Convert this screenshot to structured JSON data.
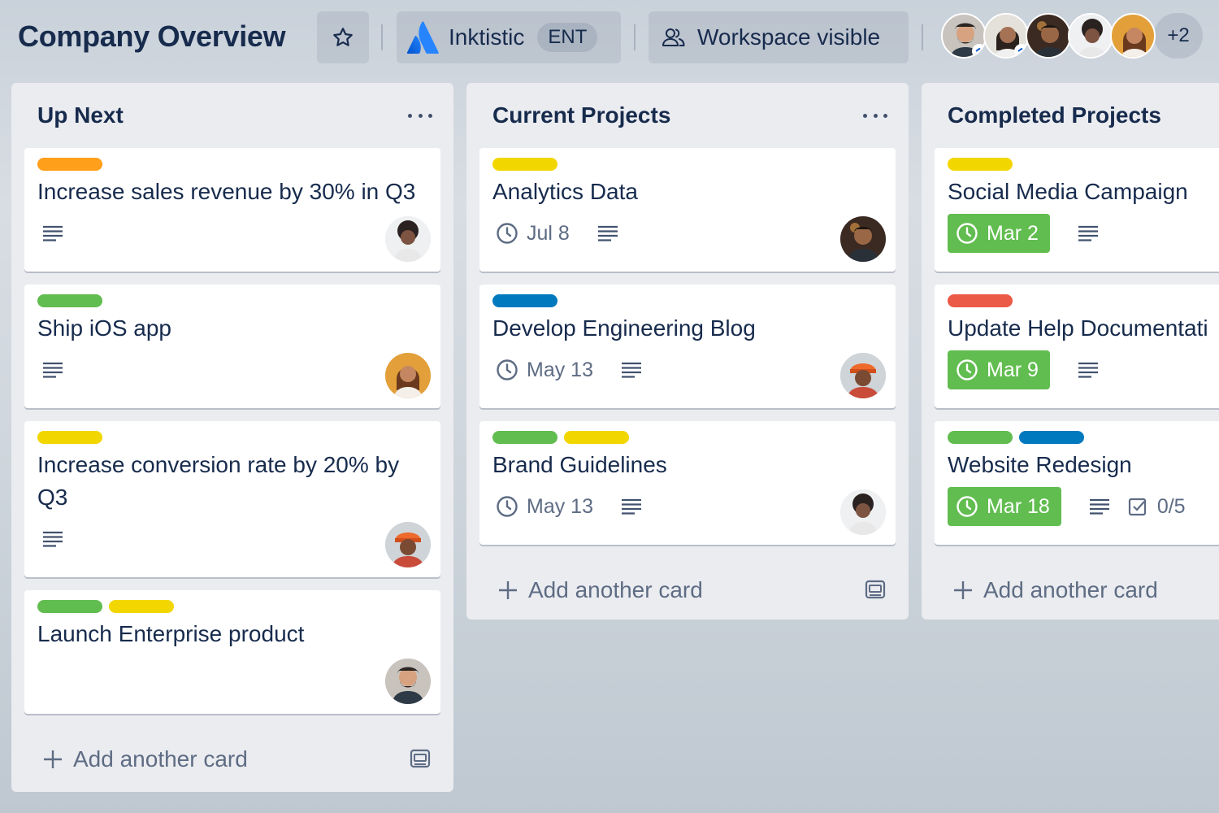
{
  "board": {
    "title": "Company Overview",
    "workspace_name": "Inktistic",
    "workspace_badge": "ENT",
    "visibility_label": "Workspace visible",
    "member_overflow": "+2",
    "star_icon": "star-icon",
    "visibility_icon": "people-icon"
  },
  "colors": {
    "orange": "#ff9f1a",
    "green": "#61bd4f",
    "yellow": "#f2d600",
    "blue": "#0079bf",
    "red": "#eb5a46",
    "atlassian_blue": "#2684ff"
  },
  "lists": [
    {
      "title": "Up Next",
      "add_label": "Add another card",
      "cards": [
        {
          "title": "Increase sales revenue by 30% in Q3",
          "labels": [
            "orange"
          ]
        },
        {
          "title": "Ship iOS app",
          "labels": [
            "green"
          ]
        },
        {
          "title": "Increase conversion rate by 20% by Q3",
          "labels": [
            "yellow"
          ]
        },
        {
          "title": "Launch Enterprise product",
          "labels": [
            "green",
            "yellow"
          ]
        }
      ]
    },
    {
      "title": "Current Projects",
      "add_label": "Add another card",
      "cards": [
        {
          "title": "Analytics Data",
          "labels": [
            "yellow"
          ],
          "due": "Jul 8"
        },
        {
          "title": "Develop Engineering Blog",
          "labels": [
            "blue"
          ],
          "due": "May 13"
        },
        {
          "title": "Brand Guidelines",
          "labels": [
            "green",
            "yellow"
          ],
          "due": "May 13"
        }
      ]
    },
    {
      "title": "Completed Projects",
      "add_label": "Add another card",
      "cards": [
        {
          "title": "Social Media Campaign",
          "labels": [
            "yellow"
          ],
          "due": "Mar 2",
          "due_complete": true
        },
        {
          "title": "Update Help Documentati",
          "labels": [
            "red"
          ],
          "due": "Mar 9",
          "due_complete": true
        },
        {
          "title": "Website Redesign",
          "labels": [
            "green",
            "blue"
          ],
          "due": "Mar 18",
          "due_complete": true,
          "checklist": "0/5"
        }
      ]
    }
  ]
}
